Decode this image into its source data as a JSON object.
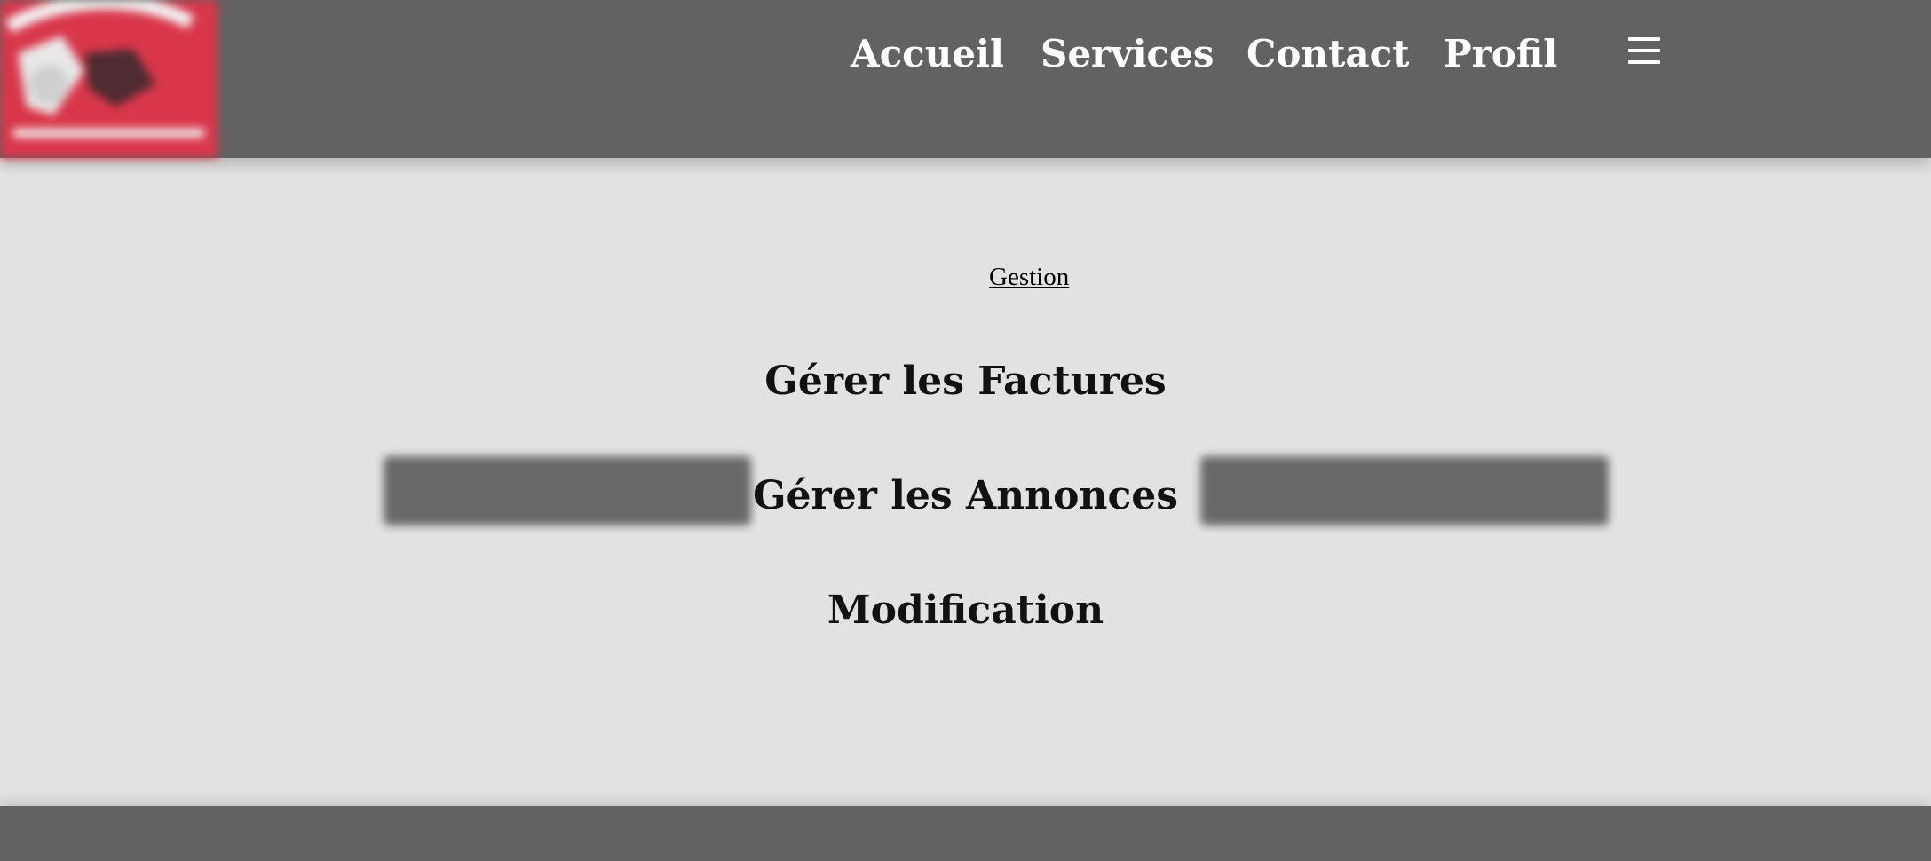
{
  "colors": {
    "header_bg": "#626262",
    "page_bg": "#e2e2e2",
    "logo_bg": "#d9364a",
    "nav_text": "#ffffff",
    "option_text": "#111111"
  },
  "header": {
    "logo_icon": "company-logo-icon",
    "site_name": "",
    "nav": [
      {
        "label": "Accueil"
      },
      {
        "label": "Services"
      },
      {
        "label": "Contact"
      },
      {
        "label": "Profil"
      }
    ],
    "menu_icon": "hamburger-menu-icon"
  },
  "main": {
    "gestion_link": "Gestion",
    "question": "",
    "options": [
      {
        "label": "Gérer les Factures"
      },
      {
        "label": "Gérer les Annonces"
      },
      {
        "label": "Modification"
      }
    ],
    "buttons": {
      "left": "",
      "right": ""
    }
  },
  "footer": {
    "text": ""
  }
}
